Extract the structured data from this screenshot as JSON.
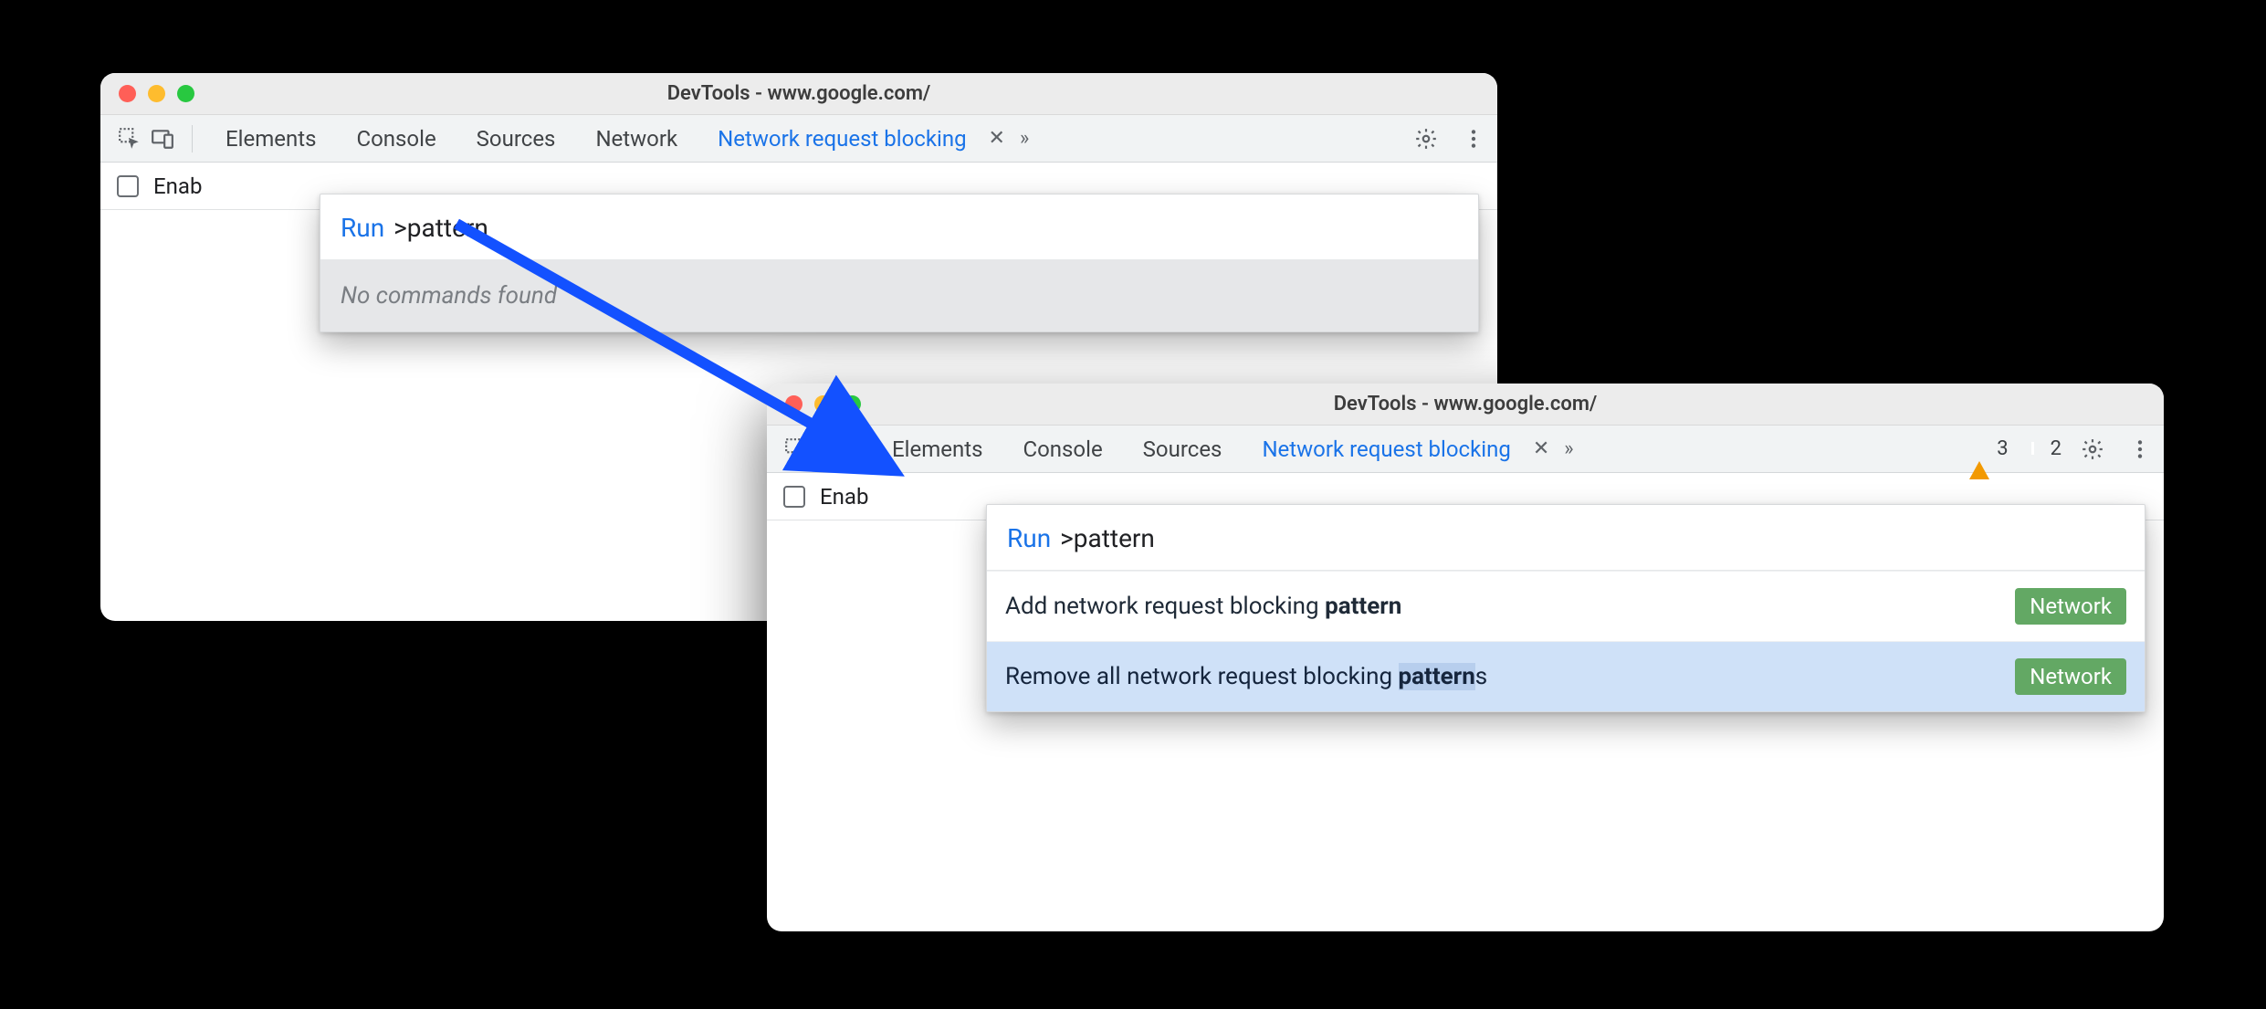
{
  "windowA": {
    "title": "DevTools - www.google.com/",
    "tabs": {
      "elements": "Elements",
      "console": "Console",
      "sources": "Sources",
      "network": "Network",
      "blocking": "Network request blocking"
    },
    "subbar": {
      "enable_label": "Enab"
    },
    "palette": {
      "run_label": "Run",
      "query": ">pattern",
      "empty": "No commands found"
    }
  },
  "windowB": {
    "title": "DevTools - www.google.com/",
    "tabs": {
      "elements": "Elements",
      "console": "Console",
      "sources": "Sources",
      "blocking": "Network request blocking"
    },
    "badges": {
      "warnings": "3",
      "issues": "2"
    },
    "subbar": {
      "enable_label": "Enab"
    },
    "palette": {
      "run_label": "Run",
      "query": ">pattern",
      "items": [
        {
          "pre": "Add network request blocking ",
          "bold": "pattern",
          "post": "",
          "pill": "Network"
        },
        {
          "pre": "Remove all network request blocking ",
          "bold": "pattern",
          "post": "s",
          "pill": "Network"
        }
      ]
    }
  }
}
